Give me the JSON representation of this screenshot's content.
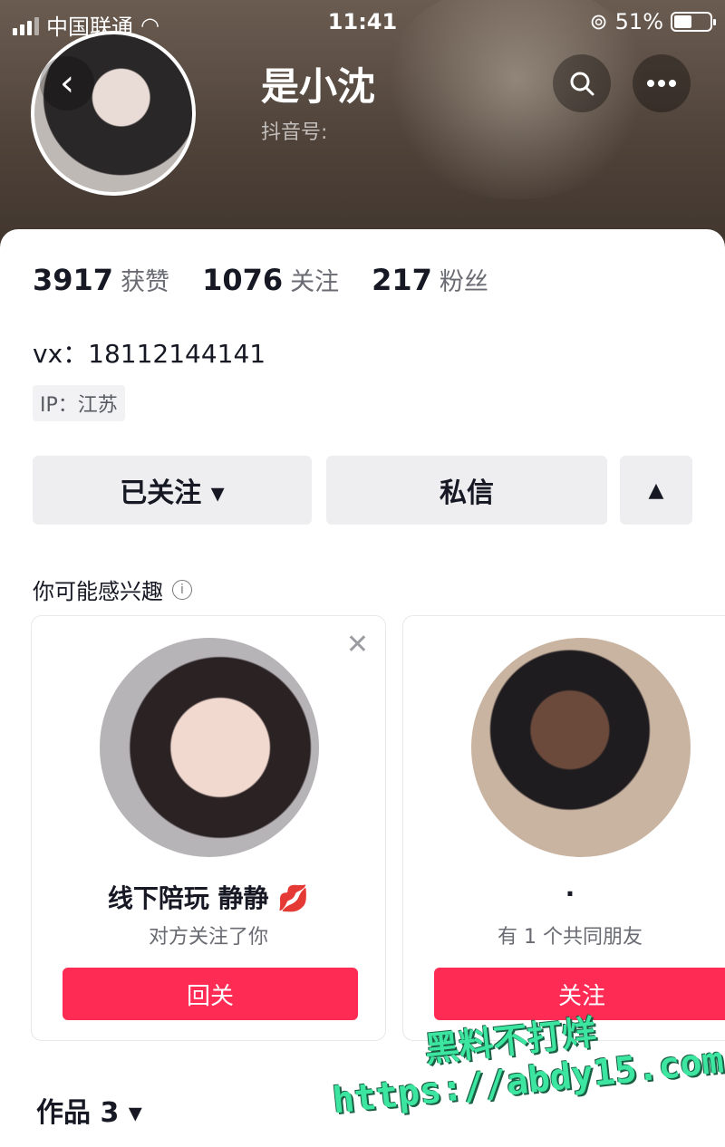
{
  "status_bar": {
    "carrier": "中国联通",
    "time": "11:41",
    "battery": "51%",
    "battery_level": 0.51
  },
  "profile": {
    "name": "是小沈",
    "douyin_id": "抖音号:"
  },
  "stats": [
    {
      "num": "3917",
      "label": "获赞"
    },
    {
      "num": "1076",
      "label": "关注"
    },
    {
      "num": "217",
      "label": "粉丝"
    }
  ],
  "bio": "vx：18112144141",
  "ip": "IP：江苏",
  "actions": {
    "followed": "已关注 ▾",
    "message": "私信",
    "expand": "▲"
  },
  "suggest": {
    "title": "你可能感兴趣"
  },
  "recommend": [
    {
      "name": "线下陪玩 静静 💋",
      "sub": "对方关注了你",
      "button": "回关"
    },
    {
      "name": "·",
      "sub": "有 1 个共同朋友",
      "button": "关注"
    }
  ],
  "works": "作品 3 ▾",
  "watermark": {
    "line1": "黑料不打烊",
    "line2": "https://abdy15.com"
  }
}
